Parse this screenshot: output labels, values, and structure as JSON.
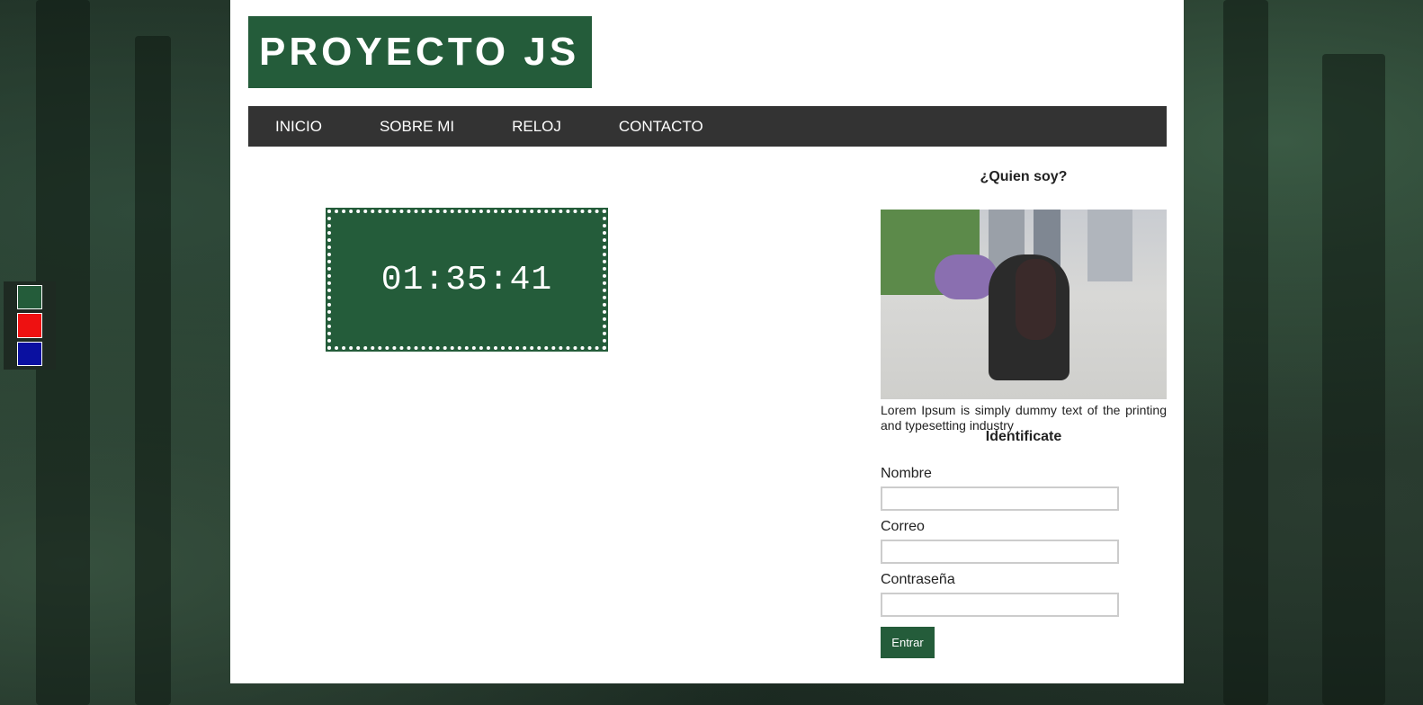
{
  "site": {
    "logo_text": "PROYECTO JS"
  },
  "nav": {
    "items": [
      "INICIO",
      "SOBRE MI",
      "RELOJ",
      "CONTACTO"
    ]
  },
  "clock": {
    "time": "01:35:41"
  },
  "sidebar": {
    "who_title": "¿Quien soy?",
    "bio": "Lorem Ipsum is simply dummy text of the printing and typesetting industry",
    "form_title": "Identificate",
    "fields": {
      "name_label": "Nombre",
      "email_label": "Correo",
      "password_label": "Contraseña"
    },
    "submit_label": "Entrar"
  },
  "theme_swatches": [
    "#245c3a",
    "#ee1111",
    "#0a10a0"
  ]
}
